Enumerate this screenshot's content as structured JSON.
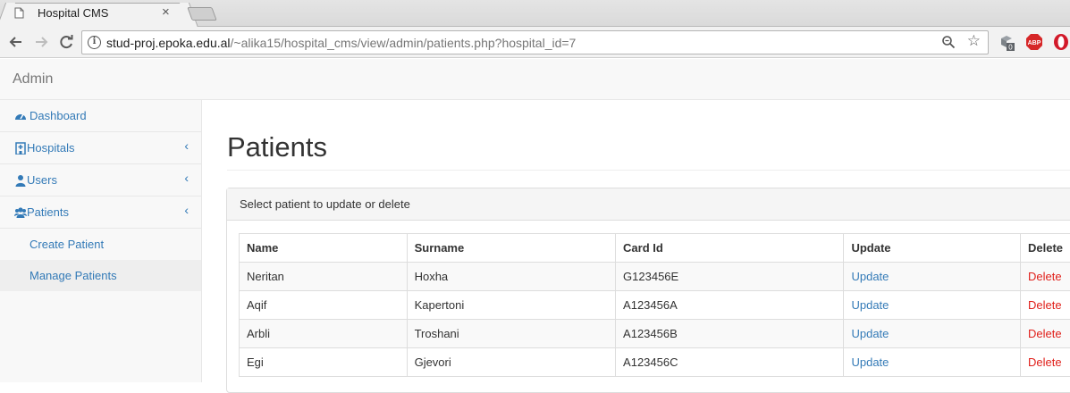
{
  "browser": {
    "tab_title": "Hospital CMS",
    "tab_close": "×",
    "url_host": "stud-proj.epoka.edu.al",
    "url_path": "/~alika15/hospital_cms/view/admin/patients.php?hospital_id=7",
    "extension_badge": "0",
    "abp_label": "ABP"
  },
  "navbar": {
    "brand": "Admin"
  },
  "sidebar": {
    "items": [
      {
        "label": "Dashboard",
        "icon": "dashboard-icon",
        "has_chevron": false
      },
      {
        "label": "Hospitals",
        "icon": "hospital-icon",
        "has_chevron": true
      },
      {
        "label": "Users",
        "icon": "user-icon",
        "has_chevron": true
      },
      {
        "label": "Patients",
        "icon": "users-icon",
        "has_chevron": true
      }
    ],
    "chevron": "‹",
    "subitems": [
      {
        "label": "Create Patient",
        "active": false
      },
      {
        "label": "Manage Patients",
        "active": true
      }
    ]
  },
  "main": {
    "title": "Patients",
    "panel_heading": "Select patient to update or delete",
    "columns": [
      "Name",
      "Surname",
      "Card Id",
      "Update",
      "Delete"
    ],
    "rows": [
      {
        "name": "Neritan",
        "surname": "Hoxha",
        "card_id": "G123456E",
        "update": "Update",
        "delete": "Delete"
      },
      {
        "name": "Aqif",
        "surname": "Kapertoni",
        "card_id": "A123456A",
        "update": "Update",
        "delete": "Delete"
      },
      {
        "name": "Arbli",
        "surname": "Troshani",
        "card_id": "A123456B",
        "update": "Update",
        "delete": "Delete"
      },
      {
        "name": "Egi",
        "surname": "Gjevori",
        "card_id": "A123456C",
        "update": "Update",
        "delete": "Delete"
      }
    ]
  },
  "colors": {
    "link": "#337ab7",
    "delete": "#e0201b",
    "brand_text": "#777777"
  }
}
